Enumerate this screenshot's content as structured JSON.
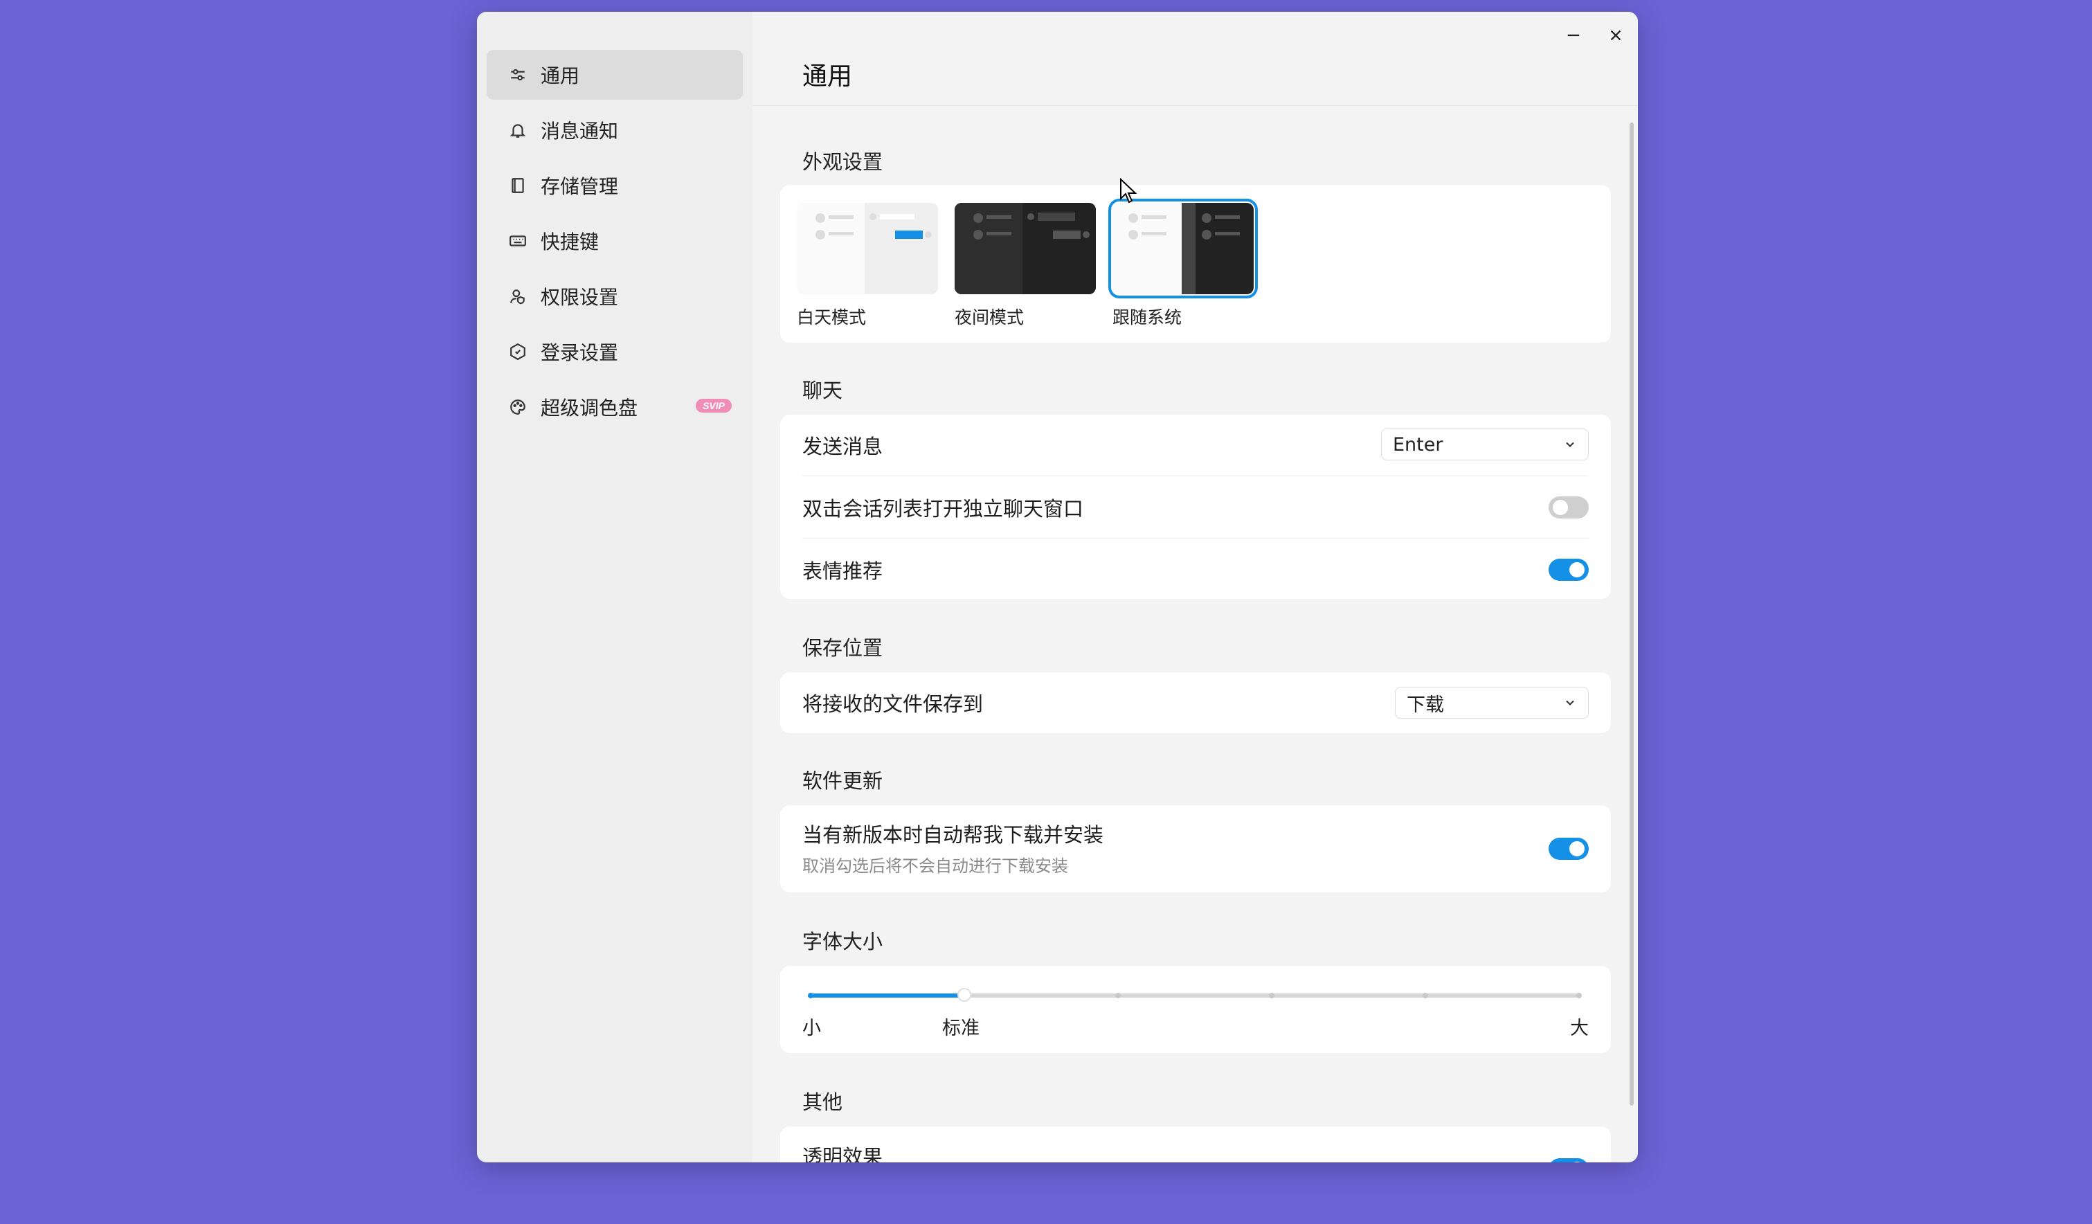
{
  "window": {
    "minimize_label": "minimize",
    "close_label": "close"
  },
  "sidebar": {
    "items": [
      {
        "label": "通用",
        "icon": "sliders-icon"
      },
      {
        "label": "消息通知",
        "icon": "bell-icon"
      },
      {
        "label": "存储管理",
        "icon": "book-icon"
      },
      {
        "label": "快捷键",
        "icon": "keyboard-icon"
      },
      {
        "label": "权限设置",
        "icon": "user-shield-icon"
      },
      {
        "label": "登录设置",
        "icon": "hexagon-icon"
      },
      {
        "label": "超级调色盘",
        "icon": "palette-icon",
        "badge": "SVIP"
      }
    ],
    "active_index": 0
  },
  "main": {
    "title": "通用",
    "appearance": {
      "section_title": "外观设置",
      "themes": [
        "白天模式",
        "夜间模式",
        "跟随系统"
      ],
      "selected": "跟随系统"
    },
    "chat": {
      "section_title": "聊天",
      "send_label": "发送消息",
      "send_value": "Enter",
      "double_click_label": "双击会话列表打开独立聊天窗口",
      "double_click_on": false,
      "emoji_label": "表情推荐",
      "emoji_on": true
    },
    "save": {
      "section_title": "保存位置",
      "label": "将接收的文件保存到",
      "value": "下载"
    },
    "update": {
      "section_title": "软件更新",
      "label": "当有新版本时自动帮我下载并安装",
      "sub": "取消勾选后将不会自动进行下载安装",
      "on": true
    },
    "font": {
      "section_title": "字体大小",
      "min_label": "小",
      "standard_label": "标准",
      "max_label": "大",
      "level": 0.2
    },
    "other": {
      "section_title": "其他",
      "transparent_label": "透明效果",
      "transparent_on": true
    }
  },
  "colors": {
    "background": "#6b63d6",
    "accent": "#1491e6",
    "svip_badge": "#f08db6"
  }
}
